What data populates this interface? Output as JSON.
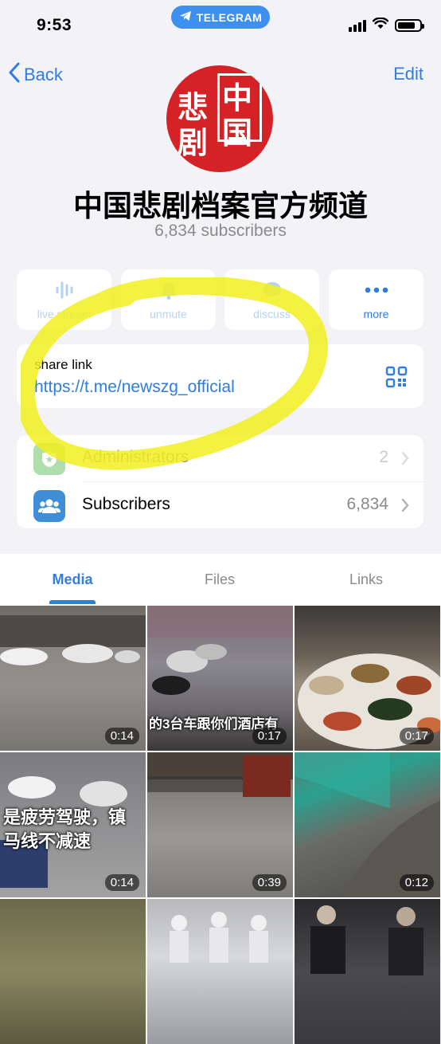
{
  "status_bar": {
    "time": "9:53",
    "app_pill": "TELEGRAM",
    "battery_level": 0.8
  },
  "nav": {
    "back_label": "Back",
    "edit_label": "Edit"
  },
  "channel": {
    "avatar_chars": [
      "悲",
      "剧",
      "中",
      "国"
    ],
    "title": "中国悲剧档案官方频道",
    "subscribers_text": "6,834 subscribers"
  },
  "actions": [
    {
      "label": "live stream",
      "icon": "waveform-icon"
    },
    {
      "label": "unmute",
      "icon": "bell-icon"
    },
    {
      "label": "discuss",
      "icon": "chat-bubble-icon"
    },
    {
      "label": "more",
      "icon": "ellipsis-icon"
    }
  ],
  "share": {
    "label": "share link",
    "url": "https://t.me/newszg_official",
    "qr_icon": "qr-code-icon"
  },
  "rows": [
    {
      "label": "Administrators",
      "value": "2",
      "icon": "admin-shield-icon",
      "color": "#4cb848"
    },
    {
      "label": "Subscribers",
      "value": "6,834",
      "icon": "people-icon",
      "color": "#3e8fd8"
    }
  ],
  "tabs": [
    {
      "label": "Media",
      "active": true
    },
    {
      "label": "Files",
      "active": false
    },
    {
      "label": "Links",
      "active": false
    }
  ],
  "media": [
    {
      "duration": "0:14",
      "overlay": ""
    },
    {
      "duration": "0:17",
      "overlay": "的3台车跟你们酒店有"
    },
    {
      "duration": "0:17",
      "overlay": ""
    },
    {
      "duration": "0:14",
      "overlay_lines": [
        "是疲劳驾驶，镇",
        "马线不减速"
      ]
    },
    {
      "duration": "0:39",
      "overlay": ""
    },
    {
      "duration": "0:12",
      "overlay": ""
    },
    {
      "duration": "",
      "overlay": ""
    },
    {
      "duration": "",
      "overlay": ""
    },
    {
      "duration": "",
      "overlay": ""
    }
  ],
  "colors": {
    "accent": "#2f7de1",
    "highlight": "#f2f01f",
    "avatar_red": "#d42226"
  }
}
